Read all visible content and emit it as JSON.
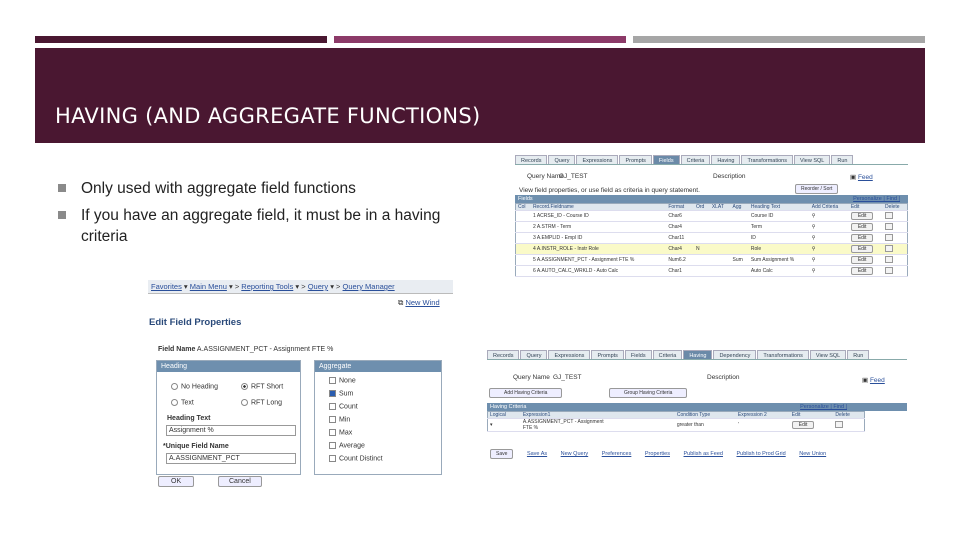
{
  "slide": {
    "title": "HAVING (AND AGGREGATE FUNCTIONS)",
    "bullets": [
      "Only used with aggregate field functions",
      "If you have an aggregate field, it must be in a having criteria"
    ],
    "colors": {
      "banner": "#4a1731",
      "bar1": "#4a1731",
      "bar2": "#8c3a68",
      "bar3": "#a6a6a6"
    }
  },
  "fields_panel": {
    "tabs": [
      "Records",
      "Query",
      "Expressions",
      "Prompts",
      "Fields",
      "Criteria",
      "Having",
      "Transformations",
      "View SQL",
      "Run"
    ],
    "active_tab": "Fields",
    "query_name_label": "Query Name",
    "query_name": "GJ_TEST",
    "description_label": "Description",
    "feed_label": "Feed",
    "hint": "View field properties, or use field as criteria in query statement.",
    "reorder_button": "Reorder / Sort",
    "grid_title": "Fields",
    "grid_nav": "Personalize | Find |",
    "columns": [
      "Col",
      "Record.Fieldname",
      "Format",
      "Ord",
      "XLAT",
      "Agg",
      "Heading Text",
      "Add Criteria",
      "Edit",
      "Delete"
    ],
    "rows": [
      {
        "record": "1 ACRSE_ID - Course ID",
        "format": "Char6",
        "ord": "",
        "agg": "",
        "heading": "Course ID",
        "edit": "Edit"
      },
      {
        "record": "2 A.STRM - Term",
        "format": "Char4",
        "ord": "",
        "agg": "",
        "heading": "Term",
        "edit": "Edit"
      },
      {
        "record": "3 A.EMPLID - Empl ID",
        "format": "Char11",
        "ord": "",
        "agg": "",
        "heading": "ID",
        "edit": "Edit"
      },
      {
        "record": "4 A.INSTR_ROLE - Instr Role",
        "format": "Char4",
        "ord": "N",
        "agg": "",
        "heading": "Role",
        "edit": "Edit"
      },
      {
        "record": "5 A.ASSIGNMENT_PCT - Assignment FTE %",
        "format": "Num6.2",
        "ord": "",
        "agg": "Sum",
        "heading": "Sum Assignment %",
        "edit": "Edit"
      },
      {
        "record": "6 A.AUTO_CALC_WRKLD - Auto Calc",
        "format": "Char1",
        "ord": "",
        "agg": "",
        "heading": "Auto Calc",
        "edit": "Edit"
      }
    ]
  },
  "edit_field": {
    "breadcrumb": [
      "Favorites",
      "Main Menu",
      "Reporting Tools",
      "Query",
      "Query Manager"
    ],
    "new_window": "New Wind",
    "title": "Edit Field Properties",
    "field_name_label": "Field Name",
    "field_name_value": "A.ASSIGNMENT_PCT - Assignment FTE %",
    "heading_panel": "Heading",
    "heading_options": [
      "No Heading",
      "RFT Short",
      "Text",
      "RFT Long"
    ],
    "heading_text_label": "Heading Text",
    "heading_text_value": "Assignment %",
    "unique_label": "*Unique Field Name",
    "unique_value": "A.ASSIGNMENT_PCT",
    "aggregate_panel": "Aggregate",
    "aggregate_options": [
      "None",
      "Sum",
      "Count",
      "Min",
      "Max",
      "Average",
      "Count Distinct"
    ],
    "selected_aggregate": "Sum",
    "ok": "OK",
    "cancel": "Cancel"
  },
  "having_panel": {
    "tabs": [
      "Records",
      "Query",
      "Expressions",
      "Prompts",
      "Fields",
      "Criteria",
      "Having",
      "Dependency",
      "Transformations",
      "View SQL",
      "Run"
    ],
    "active_tab": "Having",
    "query_name_label": "Query Name",
    "query_name": "GJ_TEST",
    "description_label": "Description",
    "feed_label": "Feed",
    "add_button": "Add Having Criteria",
    "group_button": "Group Having Criteria",
    "grid_title": "Having Criteria",
    "grid_nav": "Personalize | Find |",
    "columns": [
      "Logical",
      "Expression1",
      "Condition Type",
      "Expression 2",
      "Edit",
      "Delete"
    ],
    "row": {
      "logical": "",
      "expression1": "A.ASSIGNMENT_PCT - Assignment FTE %",
      "condition": "greater than",
      "expression2": "'",
      "edit": "Edit"
    },
    "footer_links": [
      "Save",
      "Save As",
      "New Query",
      "Preferences",
      "Properties",
      "Publish as Feed",
      "Publish to Prod Grid",
      "New Union"
    ]
  }
}
